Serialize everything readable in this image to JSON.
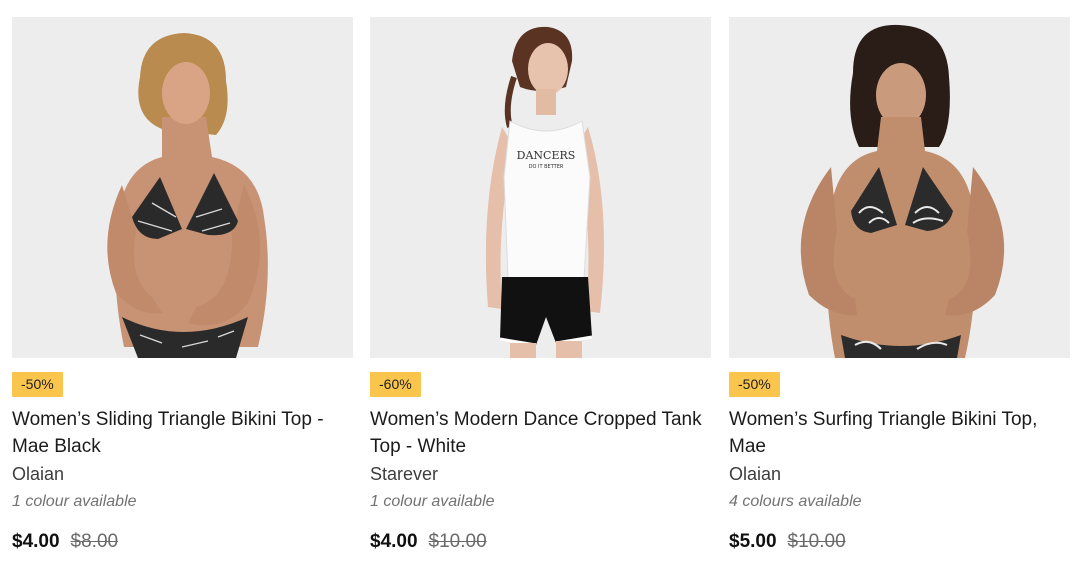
{
  "products": [
    {
      "discount": "-50%",
      "title": "Women’s Sliding Triangle Bikini Top - Mae Black",
      "brand": "Olaian",
      "colours": "1 colour available",
      "price": "$4.00",
      "old_price": "$8.00"
    },
    {
      "discount": "-60%",
      "title": "Women’s Modern Dance Cropped Tank Top - White",
      "brand": "Starever",
      "colours": "1 colour available",
      "price": "$4.00",
      "old_price": "$10.00",
      "shirt_print": "DANCERS",
      "shirt_print_sub": "DO IT BETTER"
    },
    {
      "discount": "-50%",
      "title": "Women’s Surfing Triangle Bikini Top, Mae",
      "brand": "Olaian",
      "colours": "4 colours available",
      "price": "$5.00",
      "old_price": "$10.00"
    }
  ],
  "colors": {
    "badge": "#f9c54d",
    "image_bg": "#ededed"
  }
}
